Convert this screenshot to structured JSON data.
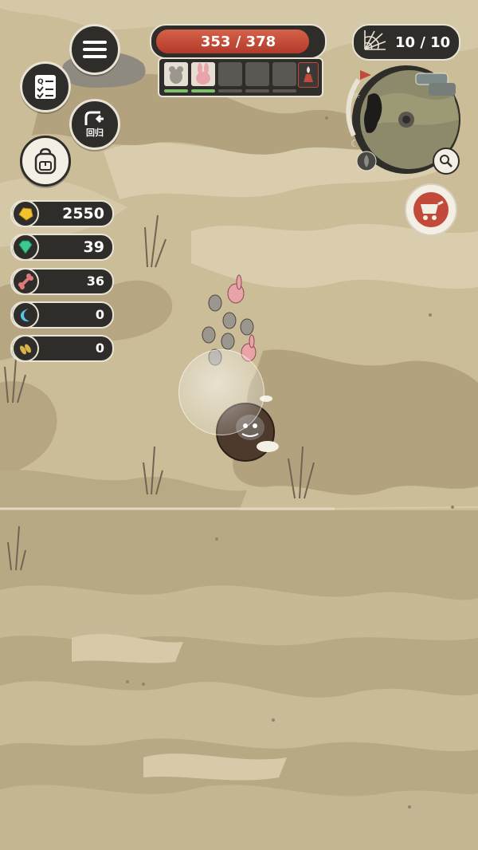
{
  "hud": {
    "health": {
      "current": 353,
      "max": 378,
      "text": "353 / 378"
    },
    "party_slots": [
      {
        "filled": true,
        "creature": "grey-rat",
        "bar": "on"
      },
      {
        "filled": true,
        "creature": "pink-rabbit",
        "bar": "on"
      },
      {
        "filled": false,
        "bar": "off"
      },
      {
        "filled": false,
        "bar": "off"
      },
      {
        "filled": false,
        "bar": "off"
      }
    ],
    "web_counter": "10 / 10"
  },
  "resources": [
    {
      "name": "gold-icon",
      "value": "2550",
      "color": "#f2c230"
    },
    {
      "name": "gem-icon",
      "value": "39",
      "color": "#3cc88f"
    },
    {
      "name": "bone-icon",
      "value": "36",
      "color": "#e07a7a"
    },
    {
      "name": "crescent-icon",
      "value": "0",
      "color": "#5bc3e8"
    },
    {
      "name": "seeds-icon",
      "value": "0",
      "color": "#d8b24a"
    }
  ],
  "buttons": {
    "menu_icon": "menu-icon",
    "quest_icon": "quest-checklist-icon",
    "return_label": "回归",
    "backpack_icon": "backpack-icon",
    "cart_icon": "cart-icon",
    "zoom_icon": "search-icon"
  },
  "colors": {
    "ground": "#cbbd98",
    "ground_dark": "#b1a27d",
    "ground_light": "#d8ccac",
    "hp_fill": "#c8462f",
    "panel_dark": "#2f2d2a",
    "panel_border": "#e9e3d6"
  }
}
